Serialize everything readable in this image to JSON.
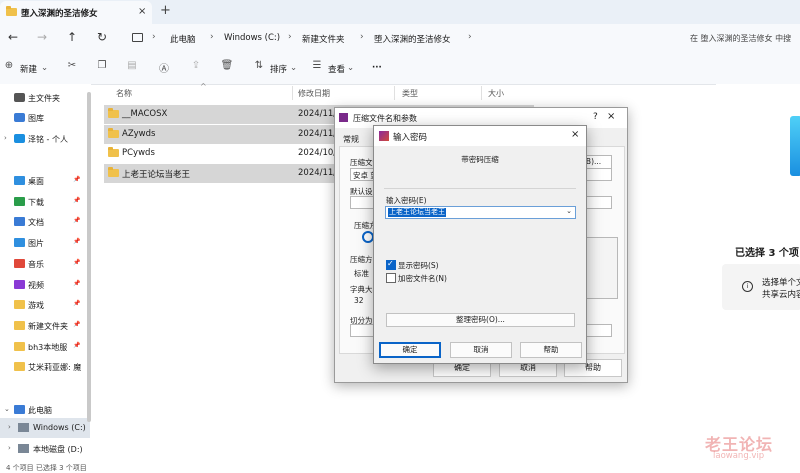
{
  "tab": {
    "title": "堕入深渊的圣洁修女",
    "close": "×",
    "new": "+"
  },
  "nav": {
    "back": "←",
    "forward": "→",
    "up": "↑",
    "refresh": "↻"
  },
  "breadcrumb": [
    "此电脑",
    "Windows (C:)",
    "新建文件夹",
    "堕入深渊的圣洁修女"
  ],
  "search": {
    "placeholder": "在 堕入深渊的圣洁修女 中搜"
  },
  "toolbar": {
    "new": "新建",
    "sort": "排序",
    "view": "查看",
    "more": "···"
  },
  "sidebar": {
    "top": [
      {
        "label": "主文件夹",
        "icon": "home-icon"
      },
      {
        "label": "图库",
        "icon": "gallery-icon"
      },
      {
        "label": "泽铭 - 个人",
        "icon": "cloud-icon"
      }
    ],
    "quick": [
      {
        "label": "桌面",
        "icon": "desktop-icon"
      },
      {
        "label": "下载",
        "icon": "download-icon"
      },
      {
        "label": "文档",
        "icon": "document-icon"
      },
      {
        "label": "图片",
        "icon": "picture-icon"
      },
      {
        "label": "音乐",
        "icon": "music-icon"
      },
      {
        "label": "视频",
        "icon": "video-icon"
      },
      {
        "label": "游戏",
        "icon": "folder-icon"
      },
      {
        "label": "新建文件夹",
        "icon": "folder-icon"
      },
      {
        "label": "bh3本地服",
        "icon": "folder-icon"
      },
      {
        "label": "艾米莉亚娜: 魔",
        "icon": "folder-icon"
      }
    ],
    "pc": {
      "label": "此电脑"
    },
    "drives": [
      {
        "label": "Windows (C:)"
      },
      {
        "label": "本地磁盘 (D:)"
      }
    ]
  },
  "columns": {
    "name": "名称",
    "date": "修改日期",
    "type": "类型",
    "size": "大小"
  },
  "files": [
    {
      "name": "__MACOSX",
      "date": "2024/11/",
      "selected": true
    },
    {
      "name": "AZywds",
      "date": "2024/11/",
      "selected": true
    },
    {
      "name": "PCywds",
      "date": "2024/10/",
      "selected": false
    },
    {
      "name": "上老王论坛当老王",
      "date": "2024/11/",
      "selected": true
    }
  ],
  "detail": {
    "count": "已选择 3 个项目",
    "hint1": "选择单个文",
    "hint2": "共享云内容"
  },
  "status": {
    "text": "4 个项目    已选择 3 个项目"
  },
  "archive_dialog": {
    "title": "压缩文件名和参数",
    "tab": "常规",
    "labels": [
      "压缩文件",
      "安卓 望",
      "默认设置",
      "压缩方",
      "压缩方",
      "标准",
      "字典大小",
      "32",
      "切分为分"
    ],
    "browse": "(B)...",
    "ok": "确定",
    "cancel": "取消",
    "help": "帮助",
    "help_icon": "?",
    "close": "×"
  },
  "password_dialog": {
    "title": "输入密码",
    "subtitle": "带密码压缩",
    "label": "输入密码(E)",
    "value": "上老王论坛当老王",
    "show_password": "显示密码(S)",
    "encrypt_names": "加密文件名(N)",
    "organize": "整理密码(O)...",
    "ok": "确定",
    "cancel": "取消",
    "help": "帮助",
    "close": "×"
  },
  "watermark": {
    "cn": "老王论坛",
    "url": "laowang.vip"
  }
}
